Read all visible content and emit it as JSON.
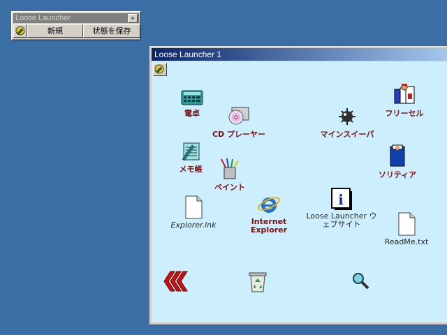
{
  "mini_window": {
    "title": "Loose Launcher",
    "close_glyph": "×",
    "buttons": {
      "new": "新規",
      "save_state": "状態を保存"
    }
  },
  "main_window": {
    "title": "Loose Launcher 1",
    "icons": {
      "calc": "電卓",
      "cd_player": "CD プレーヤー",
      "minesweeper": "マインスイーパ",
      "freecell": "フリーセル",
      "memo": "メモ帳",
      "paint": "ペイント",
      "solitaire": "ソリティア",
      "explorer_lnk": "Explorer.lnk",
      "internet_explorer": "Internet Explorer",
      "website": "Loose Launcher ウェブサイト",
      "readme": "ReadMe.txt"
    }
  },
  "colors": {
    "desktop": "#3a6ea5",
    "client": "#cdeefc",
    "label": "#7a1010"
  }
}
